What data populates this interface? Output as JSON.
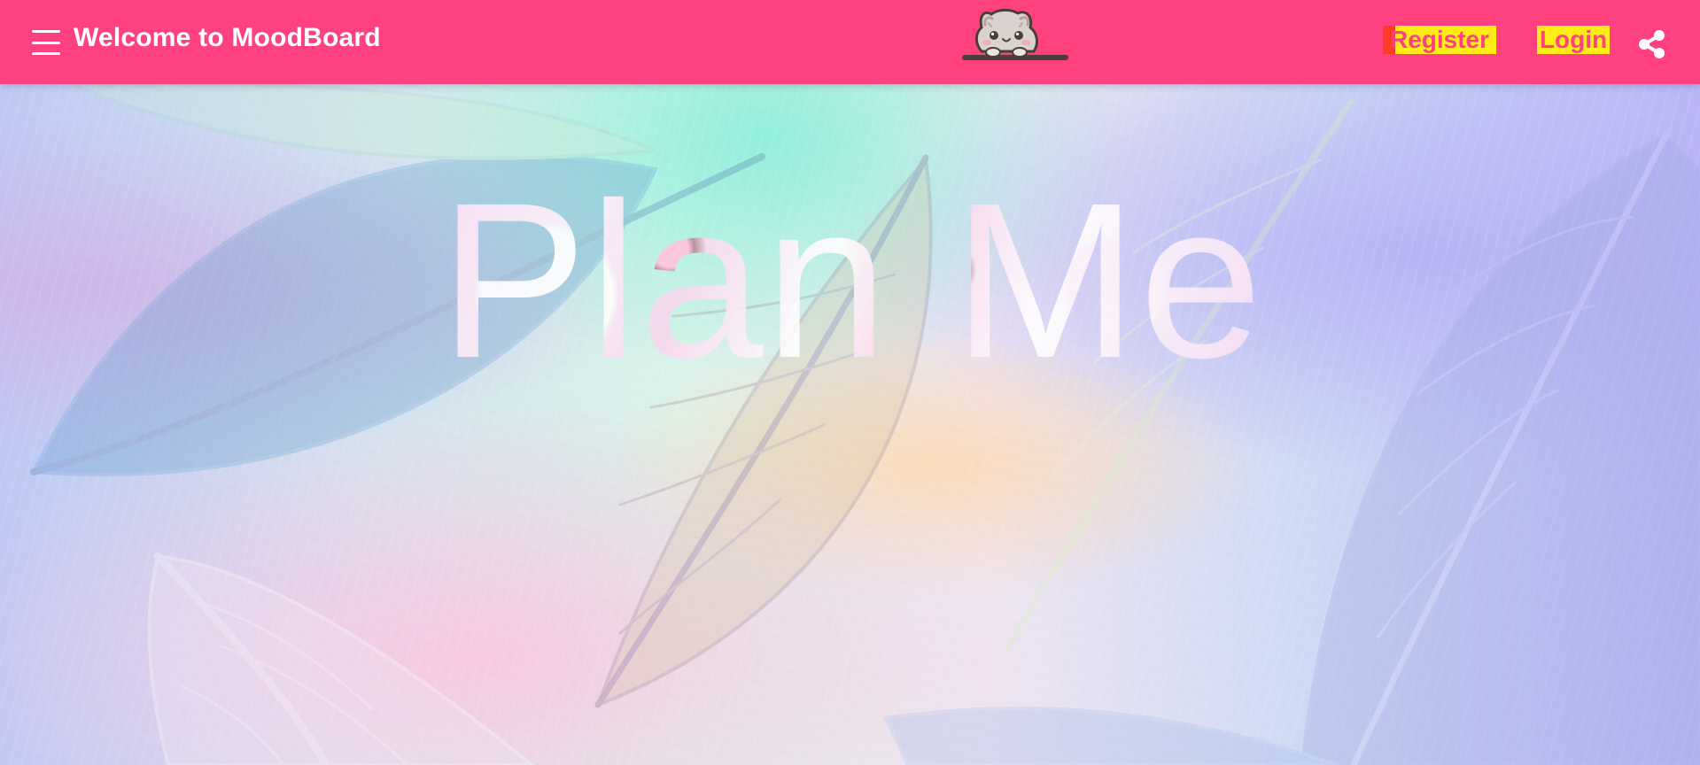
{
  "app": {
    "title": "Welcome to MoodBoard",
    "hero_title": "Plan Me"
  },
  "header": {
    "register_label": "Register",
    "login_label": "Login",
    "menu_icon": "hamburger-menu-icon",
    "logo_icon": "cat-logo-icon",
    "share_icon": "share-icon"
  },
  "colors": {
    "header": "#ff4180",
    "auth_highlight": "#ffeb16",
    "auth_text": "#ff4180",
    "hero_text": "#f7d8ee"
  }
}
